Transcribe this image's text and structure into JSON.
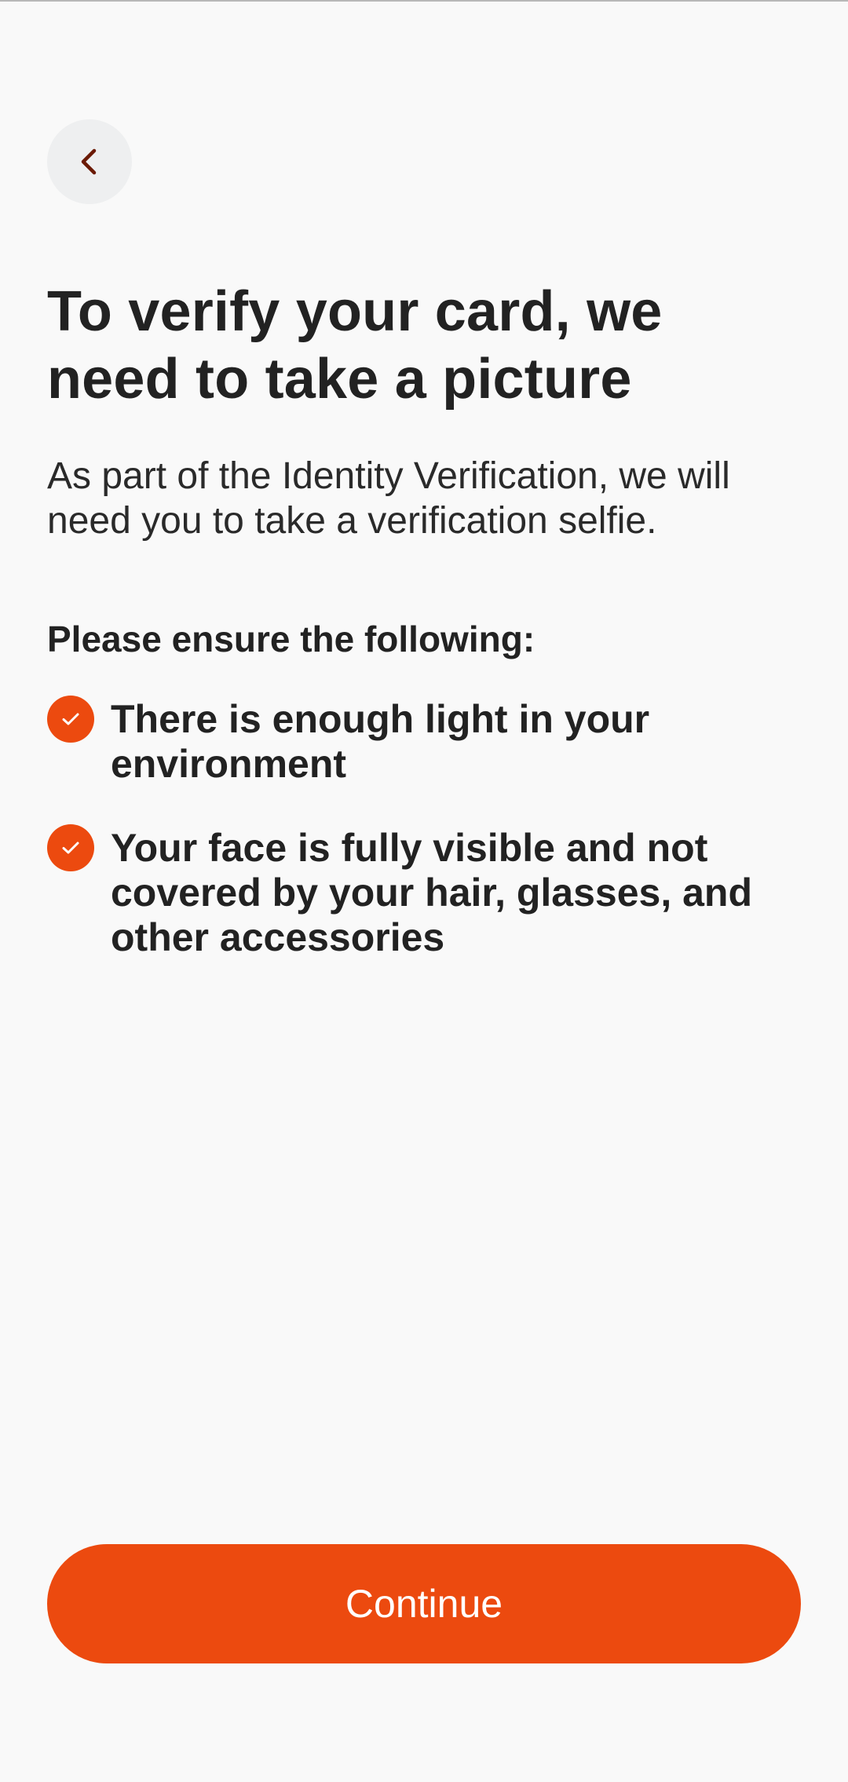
{
  "header": {
    "back_icon": "chevron-left-icon"
  },
  "main": {
    "title": "To verify your card, we need to take a picture",
    "description": "As part of the Identity Verification, we will need you to take a verification selfie.",
    "checklist_heading": "Please ensure the following:",
    "checklist": [
      {
        "icon": "check-circle-icon",
        "text": "There is enough light in your environment"
      },
      {
        "icon": "check-circle-icon",
        "text": "Your face is fully visible and not covered by your hair, glasses, and other accessories"
      }
    ]
  },
  "footer": {
    "continue_label": "Continue"
  },
  "colors": {
    "accent": "#ec4a0f",
    "back_icon": "#6b1a05",
    "background": "#f9f9f9",
    "back_button_bg": "#eeeff0",
    "text": "#222222"
  }
}
